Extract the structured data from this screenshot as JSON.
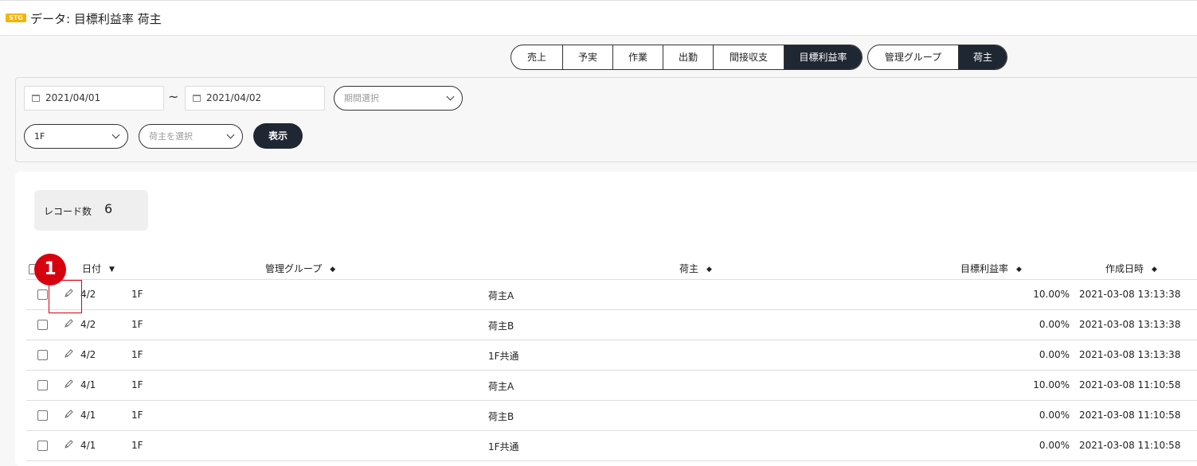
{
  "header": {
    "env_badge": "STG",
    "title": "データ: 目標利益率 荷主"
  },
  "tabs_group1": [
    {
      "label": "売上",
      "active": false
    },
    {
      "label": "予実",
      "active": false
    },
    {
      "label": "作業",
      "active": false
    },
    {
      "label": "出勤",
      "active": false
    },
    {
      "label": "間接収支",
      "active": false
    },
    {
      "label": "目標利益率",
      "active": true
    }
  ],
  "tabs_group2": [
    {
      "label": "管理グループ",
      "active": false
    },
    {
      "label": "荷主",
      "active": true
    }
  ],
  "filters": {
    "date_from": "2021/04/01",
    "separator": "~",
    "date_to": "2021/04/02",
    "period_placeholder": "期間選択",
    "group_value": "1F",
    "shipper_placeholder": "荷主を選択",
    "show_button": "表示"
  },
  "records": {
    "label": "レコード数",
    "count": "6"
  },
  "table": {
    "headers": {
      "date": "日付",
      "group": "管理グループ",
      "shipper": "荷主",
      "rate": "目標利益率",
      "created": "作成日時"
    },
    "rows": [
      {
        "date": "4/2",
        "group": "1F",
        "shipper": "荷主A",
        "rate": "10.00%",
        "created": "2021-03-08 13:13:38"
      },
      {
        "date": "4/2",
        "group": "1F",
        "shipper": "荷主B",
        "rate": "0.00%",
        "created": "2021-03-08 13:13:38"
      },
      {
        "date": "4/2",
        "group": "1F",
        "shipper": "1F共通",
        "rate": "0.00%",
        "created": "2021-03-08 13:13:38"
      },
      {
        "date": "4/1",
        "group": "1F",
        "shipper": "荷主A",
        "rate": "10.00%",
        "created": "2021-03-08 11:10:58"
      },
      {
        "date": "4/1",
        "group": "1F",
        "shipper": "荷主B",
        "rate": "0.00%",
        "created": "2021-03-08 11:10:58"
      },
      {
        "date": "4/1",
        "group": "1F",
        "shipper": "1F共通",
        "rate": "0.00%",
        "created": "2021-03-08 11:10:58"
      }
    ]
  },
  "annotation": {
    "step_number": "1"
  }
}
